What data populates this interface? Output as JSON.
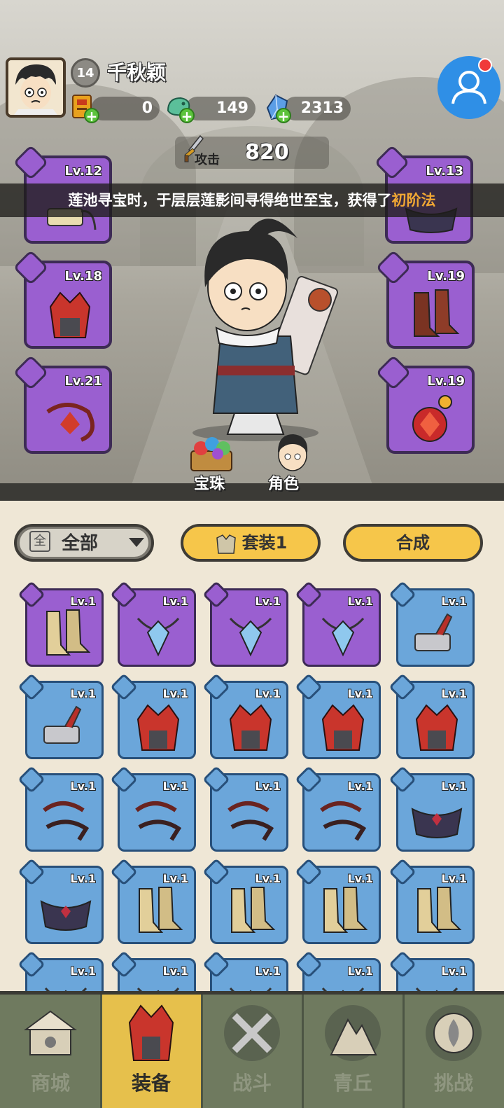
{
  "player": {
    "name": "千秋颖",
    "level": "14",
    "resources": [
      {
        "icon": "scroll-token-icon",
        "value": "0"
      },
      {
        "icon": "jade-dragon-icon",
        "value": "149"
      },
      {
        "icon": "blue-crystal-icon",
        "value": "2313"
      }
    ],
    "attack_label": "攻击",
    "attack_value": "820"
  },
  "banner": {
    "text": "莲池寻宝时，于层层莲影间寻得绝世至宝，获得了",
    "highlight": "初阶法"
  },
  "equipped": [
    {
      "slot": "weapon",
      "level": "Lv.12"
    },
    {
      "slot": "belt",
      "level": "Lv.13"
    },
    {
      "slot": "helmet",
      "level": "Lv.18"
    },
    {
      "slot": "boots",
      "level": "Lv.19"
    },
    {
      "slot": "bracer",
      "level": "Lv.21"
    },
    {
      "slot": "necklace",
      "level": "Lv.19"
    }
  ],
  "hero_buttons": {
    "orbs": "宝珠",
    "character": "角色"
  },
  "toolbar": {
    "filter_icon": "全",
    "filter_label": "全部",
    "set_label": "套装1",
    "combine_label": "合成"
  },
  "inventory": [
    {
      "rarity": "purple",
      "type": "boots",
      "level": "Lv.1"
    },
    {
      "rarity": "purple",
      "type": "necklace",
      "level": "Lv.1"
    },
    {
      "rarity": "purple",
      "type": "necklace",
      "level": "Lv.1"
    },
    {
      "rarity": "purple",
      "type": "necklace",
      "level": "Lv.1"
    },
    {
      "rarity": "blue",
      "type": "weapon",
      "level": "Lv.1"
    },
    {
      "rarity": "blue",
      "type": "weapon",
      "level": "Lv.1"
    },
    {
      "rarity": "blue",
      "type": "helmet",
      "level": "Lv.1"
    },
    {
      "rarity": "blue",
      "type": "helmet",
      "level": "Lv.1"
    },
    {
      "rarity": "blue",
      "type": "helmet",
      "level": "Lv.1"
    },
    {
      "rarity": "blue",
      "type": "helmet",
      "level": "Lv.1"
    },
    {
      "rarity": "blue",
      "type": "bracer",
      "level": "Lv.1"
    },
    {
      "rarity": "blue",
      "type": "bracer",
      "level": "Lv.1"
    },
    {
      "rarity": "blue",
      "type": "bracer",
      "level": "Lv.1"
    },
    {
      "rarity": "blue",
      "type": "bracer",
      "level": "Lv.1"
    },
    {
      "rarity": "blue",
      "type": "belt",
      "level": "Lv.1"
    },
    {
      "rarity": "blue",
      "type": "belt",
      "level": "Lv.1"
    },
    {
      "rarity": "blue",
      "type": "boots",
      "level": "Lv.1"
    },
    {
      "rarity": "blue",
      "type": "boots",
      "level": "Lv.1"
    },
    {
      "rarity": "blue",
      "type": "boots",
      "level": "Lv.1"
    },
    {
      "rarity": "blue",
      "type": "boots",
      "level": "Lv.1"
    },
    {
      "rarity": "blue",
      "type": "necklace",
      "level": "Lv.1"
    },
    {
      "rarity": "blue",
      "type": "necklace",
      "level": "Lv.1"
    },
    {
      "rarity": "blue",
      "type": "necklace",
      "level": "Lv.1"
    },
    {
      "rarity": "blue",
      "type": "necklace",
      "level": "Lv.1"
    },
    {
      "rarity": "blue",
      "type": "necklace",
      "level": "Lv.1"
    }
  ],
  "nav": [
    {
      "label": "商城",
      "icon": "shop-icon"
    },
    {
      "label": "装备",
      "icon": "equipment-icon",
      "active": true
    },
    {
      "label": "战斗",
      "icon": "battle-icon"
    },
    {
      "label": "青丘",
      "icon": "mountain-icon"
    },
    {
      "label": "挑战",
      "icon": "challenge-icon"
    }
  ],
  "colors": {
    "purple": "#9a5fd0",
    "blue": "#6ba6da",
    "accent": "#f6c64a",
    "highlight": "#f0a734"
  }
}
